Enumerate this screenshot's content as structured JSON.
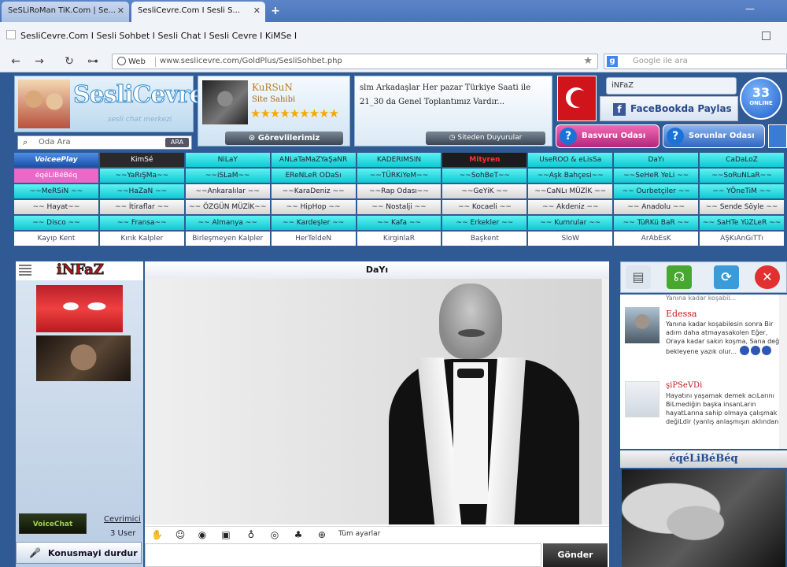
{
  "browser": {
    "tabs": [
      {
        "label": "SeSLiRoMan TiK.Com | Se..."
      },
      {
        "label": "SesliCevre.Com I Sesli S..."
      }
    ],
    "page_title": "SesliCevre.Com I Sesli Sohbet I Sesli Chat I Sesli Cevre I KiMSe I",
    "address": {
      "badge": "Web",
      "url": "www.seslicevre.com/GoldPlus/SesliSohbet.php"
    },
    "search_placeholder": "Google ile ara",
    "google_letter": "g"
  },
  "header": {
    "logo_text": "SesliCevre",
    "logo_sub": "sesli chat merkezi",
    "room_search": {
      "placeholder": "Oda Ara",
      "button": "ARA"
    },
    "owner": {
      "name": "KuRSuN",
      "role": "Site Sahibi",
      "stars": "★★★★★★★★★",
      "button": "Görevlilerimiz"
    },
    "announcement": {
      "text": "slm Arkadaşlar Her pazar Türkiye Saati ile 21_30 da Genel Toplantımız Vardır...",
      "button": "Siteden Duyurular"
    },
    "current_user": "iNFaZ",
    "facebook": {
      "letter": "f",
      "label": "FaceBookda Paylas"
    },
    "online": {
      "count": "33",
      "label": "ONLINE"
    },
    "basvuru_button": "Basvuru Odası",
    "sorun_button": "Sorunlar Odası"
  },
  "rooms": [
    {
      "label": "VoiceePlay",
      "style": "logo"
    },
    {
      "label": "KimSé",
      "style": "dk"
    },
    {
      "label": "NiLaY",
      "style": "cy"
    },
    {
      "label": "ANLaTaMaZYaŞaNR",
      "style": "cy"
    },
    {
      "label": "KADERIMSIN",
      "style": "cy"
    },
    {
      "label": "Mityren",
      "style": "rd"
    },
    {
      "label": "UseROO & eLisSa",
      "style": "cy"
    },
    {
      "label": "DaYı",
      "style": "cy"
    },
    {
      "label": "CaDaLoZ",
      "style": "cy"
    },
    {
      "label": "éqéLiBéBéq",
      "style": "mg"
    },
    {
      "label": "~~YaRıŞMa~~",
      "style": "cy"
    },
    {
      "label": "~~iSLaM~~",
      "style": "cy"
    },
    {
      "label": "EReNLeR ODaSı",
      "style": "cy"
    },
    {
      "label": "~~TÜRKiYeM~~",
      "style": "cy"
    },
    {
      "label": "~~SohBeT~~",
      "style": "cy"
    },
    {
      "label": "~~Aşk Bahçesi~~",
      "style": "cy"
    },
    {
      "label": "~~SeHeR YeLi ~~",
      "style": "cy"
    },
    {
      "label": "~~SoRuNLaR~~",
      "style": "cy"
    },
    {
      "label": "~~MeRSiN ~~",
      "style": "cy"
    },
    {
      "label": "~~HaZaN ~~",
      "style": "cy"
    },
    {
      "label": "~~Ankaralılar ~~",
      "style": "gr"
    },
    {
      "label": "~~KaraDeniz ~~",
      "style": "gr"
    },
    {
      "label": "~~Rap Odası~~",
      "style": "gr"
    },
    {
      "label": "~~GeYiK ~~",
      "style": "gr"
    },
    {
      "label": "~~CaNLı MÜZİK ~~",
      "style": "gr"
    },
    {
      "label": "~~ Ourbetçiler ~~",
      "style": "cy"
    },
    {
      "label": "~~ YÖneTiM ~~",
      "style": "cy"
    },
    {
      "label": "~~ Hayat~~",
      "style": "gr"
    },
    {
      "label": "~~ İtiraflar ~~",
      "style": "gr"
    },
    {
      "label": "~~ ÖZGÜN MÜZİK~~",
      "style": "gr"
    },
    {
      "label": "~~ HipHop ~~",
      "style": "gr"
    },
    {
      "label": "~~ Nostalji ~~",
      "style": "gr"
    },
    {
      "label": "~~ Kocaeli ~~",
      "style": "gr"
    },
    {
      "label": "~~ Akdeniz ~~",
      "style": "gr"
    },
    {
      "label": "~~ Anadolu ~~",
      "style": "gr"
    },
    {
      "label": "~~ Sende Söyle ~~",
      "style": "gr"
    },
    {
      "label": "~~ Disco ~~",
      "style": "cy"
    },
    {
      "label": "~~ Fransa~~",
      "style": "cy"
    },
    {
      "label": "~~ Almanya ~~",
      "style": "cy"
    },
    {
      "label": "~~ Kardeşler ~~",
      "style": "cy"
    },
    {
      "label": "~~ Kafa ~~",
      "style": "cy"
    },
    {
      "label": "~~ Erkekler ~~",
      "style": "cy"
    },
    {
      "label": "~~ Kumrular ~~",
      "style": "cy"
    },
    {
      "label": "~~ TüRKü BaR ~~",
      "style": "cy"
    },
    {
      "label": "~~ SaHTe YüZLeR ~~",
      "style": "cy"
    },
    {
      "label": "Kayıp Kent",
      "style": "wh"
    },
    {
      "label": "Kırık Kalpler",
      "style": "wh"
    },
    {
      "label": "Birleşmeyen Kalpler",
      "style": "wh"
    },
    {
      "label": "HerTeldeN",
      "style": "wh"
    },
    {
      "label": "KirginlaR",
      "style": "wh"
    },
    {
      "label": "Başkent",
      "style": "wh"
    },
    {
      "label": "SloW",
      "style": "wh"
    },
    {
      "label": "ArAbEsK",
      "style": "wh"
    },
    {
      "label": "AŞKıAnGıTTı",
      "style": "wh"
    }
  ],
  "left_panel": {
    "speaker_name": "iNFaZ",
    "cevrimici": "Cevrimici",
    "user_count": "3 User",
    "stop_button": "Konusmayi durdur"
  },
  "center": {
    "title": "DaYı",
    "settings_label": "Tüm ayarlar",
    "send_button": "Gönder"
  },
  "right_panel": {
    "messages": [
      {
        "name": "Edessa",
        "text": "Yanına kadar koşabilesin sonra Bir adım daha atmayasakolen Eğer, Oraya kadar sakın koşma, Sana değil bekleyene yazık olur..."
      },
      {
        "name": "şiPSeVDi",
        "text": "Hayatını yaşamak demek acıLarını BiLmediğin başka insanLarın hayatLarına sahip olmaya çalışmak değiLdir (yanlış anlaşmışın aklından)"
      }
    ],
    "top_fragment": "Yanına kadar koşabil...",
    "banner_name": "éqéLiBéBéq"
  }
}
